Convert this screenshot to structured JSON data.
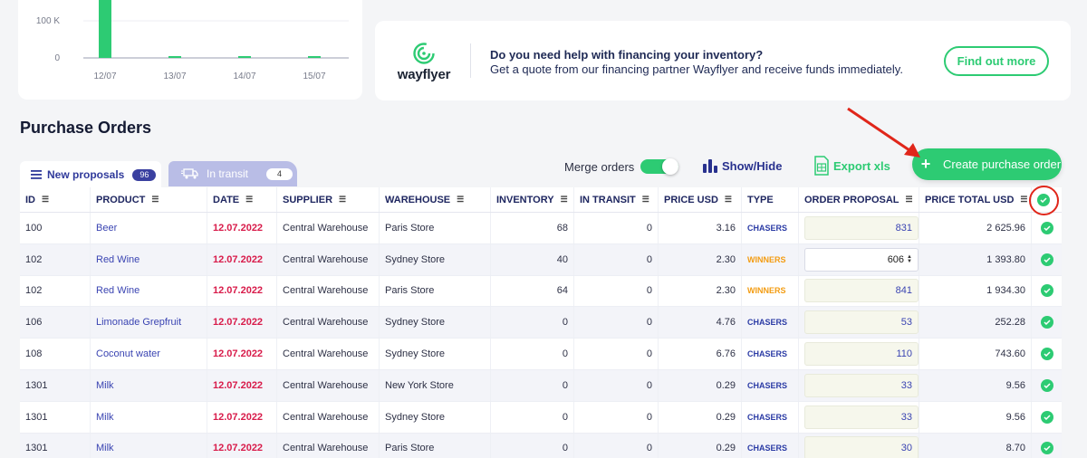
{
  "chart": {
    "chart_data": {
      "type": "bar",
      "categories": [
        "12/07",
        "13/07",
        "14/07",
        "15/07"
      ],
      "values": [
        400000,
        2500,
        1500,
        1500
      ],
      "ytick_labels": [
        "100 K",
        "0"
      ],
      "yticks": [
        100000,
        0
      ],
      "ylim": [
        0,
        100000
      ],
      "color": "#2dcb73"
    }
  },
  "banner": {
    "brand": "wayflyer",
    "title": "Do you need help with financing your inventory?",
    "text": "Get a quote from our financing partner Wayflyer and receive funds immediately.",
    "cta": "Find out more"
  },
  "section_title": "Purchase Orders",
  "tabs": [
    {
      "label": "New proposals",
      "count": "96"
    },
    {
      "label": "In transit",
      "count": "4"
    }
  ],
  "toolbar": {
    "merge_label": "Merge orders",
    "merge_on": true,
    "showhide": "Show/Hide",
    "export": "Export xls",
    "create": "Create purchase order"
  },
  "columns": [
    "ID",
    "PRODUCT",
    "DATE",
    "SUPPLIER",
    "WAREHOUSE",
    "INVENTORY",
    "IN TRANSIT",
    "PRICE USD",
    "TYPE",
    "ORDER PROPOSAL",
    "PRICE TOTAL USD"
  ],
  "rows": [
    {
      "id": "100",
      "product": "Beer",
      "date": "12.07.2022",
      "supplier": "Central Warehouse",
      "warehouse": "Paris Store",
      "inventory": "68",
      "in_transit": "0",
      "price": "3.16",
      "type": "CHASERS",
      "proposal": "831",
      "total": "2 625.96"
    },
    {
      "id": "102",
      "product": "Red Wine",
      "date": "12.07.2022",
      "supplier": "Central Warehouse",
      "warehouse": "Sydney Store",
      "inventory": "40",
      "in_transit": "0",
      "price": "2.30",
      "type": "WINNERS",
      "proposal": "606",
      "total": "1 393.80"
    },
    {
      "id": "102",
      "product": "Red Wine",
      "date": "12.07.2022",
      "supplier": "Central Warehouse",
      "warehouse": "Paris Store",
      "inventory": "64",
      "in_transit": "0",
      "price": "2.30",
      "type": "WINNERS",
      "proposal": "841",
      "total": "1 934.30"
    },
    {
      "id": "106",
      "product": "Limonade Grepfruit",
      "date": "12.07.2022",
      "supplier": "Central Warehouse",
      "warehouse": "Sydney Store",
      "inventory": "0",
      "in_transit": "0",
      "price": "4.76",
      "type": "CHASERS",
      "proposal": "53",
      "total": "252.28"
    },
    {
      "id": "108",
      "product": "Coconut water",
      "date": "12.07.2022",
      "supplier": "Central Warehouse",
      "warehouse": "Sydney Store",
      "inventory": "0",
      "in_transit": "0",
      "price": "6.76",
      "type": "CHASERS",
      "proposal": "110",
      "total": "743.60"
    },
    {
      "id": "1301",
      "product": "Milk",
      "date": "12.07.2022",
      "supplier": "Central Warehouse",
      "warehouse": "New York Store",
      "inventory": "0",
      "in_transit": "0",
      "price": "0.29",
      "type": "CHASERS",
      "proposal": "33",
      "total": "9.56"
    },
    {
      "id": "1301",
      "product": "Milk",
      "date": "12.07.2022",
      "supplier": "Central Warehouse",
      "warehouse": "Sydney Store",
      "inventory": "0",
      "in_transit": "0",
      "price": "0.29",
      "type": "CHASERS",
      "proposal": "33",
      "total": "9.56"
    },
    {
      "id": "1301",
      "product": "Milk",
      "date": "12.07.2022",
      "supplier": "Central Warehouse",
      "warehouse": "Paris Store",
      "inventory": "0",
      "in_transit": "0",
      "price": "0.29",
      "type": "CHASERS",
      "proposal": "30",
      "total": "8.70"
    }
  ],
  "colors": {
    "accent_green": "#2dcb73",
    "primary_blue": "#3a40a0",
    "date_red": "#d81b4a",
    "winners_orange": "#f39c12",
    "annotation_red": "#e0261a"
  }
}
